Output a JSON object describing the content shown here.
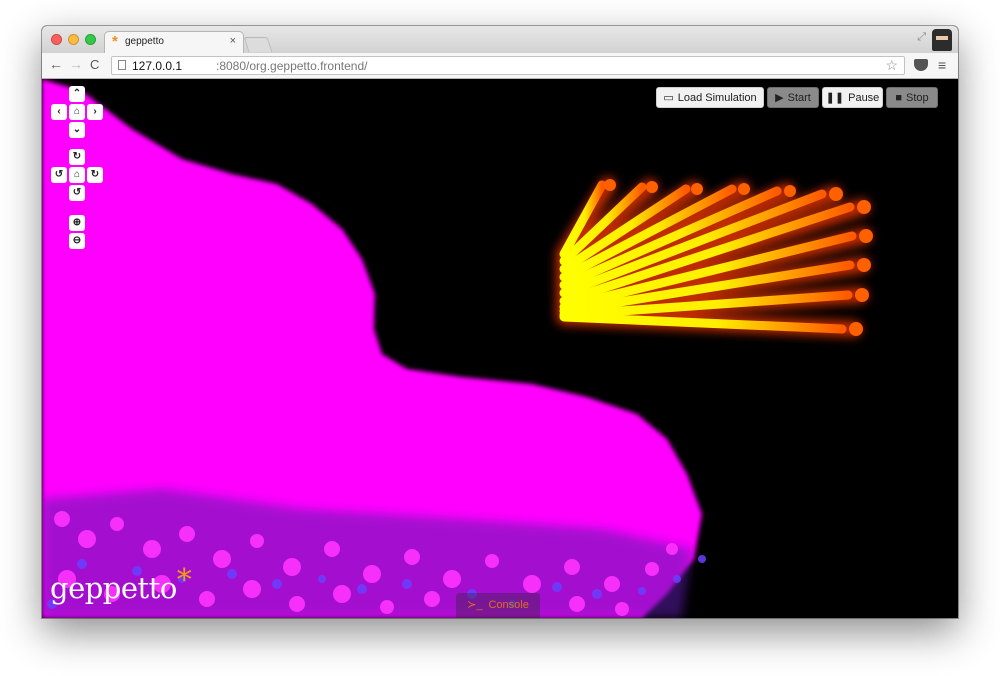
{
  "browser": {
    "tab_title": "geppetto",
    "tab_close": "×",
    "url_host": "127.0.0.1",
    "url_path": ":8080/org.geppetto.frontend/"
  },
  "icons": {
    "favicon": "*",
    "back": "←",
    "forward": "→",
    "reload": "C",
    "star": "☆",
    "menu": "≡",
    "resize": "⤢",
    "pan_up": "⌃",
    "pan_left": "‹",
    "pan_right": "›",
    "pan_down": "⌄",
    "home": "⌂",
    "rotate_up": "↻",
    "rotate_left": "↺",
    "rotate_right": "↻",
    "rotate_down": "↺",
    "zoom_in": "⊕",
    "zoom_out": "⊖",
    "folder": "▭",
    "play": "▶",
    "pause": "❚❚",
    "stop": "■",
    "console": "≻_"
  },
  "toolbar": {
    "load_label": "Load Simulation",
    "start_label": "Start",
    "pause_label": "Pause",
    "stop_label": "Stop"
  },
  "logo": {
    "text": "geppetto",
    "star": "*"
  },
  "console": {
    "label": "Console"
  },
  "colors": {
    "particles_main": "#ff00ff",
    "particles_blue": "#7a3cff",
    "tentacles_core": "#ffff00",
    "tentacles_glow": "#ff4000",
    "accent": "#f39c12"
  }
}
